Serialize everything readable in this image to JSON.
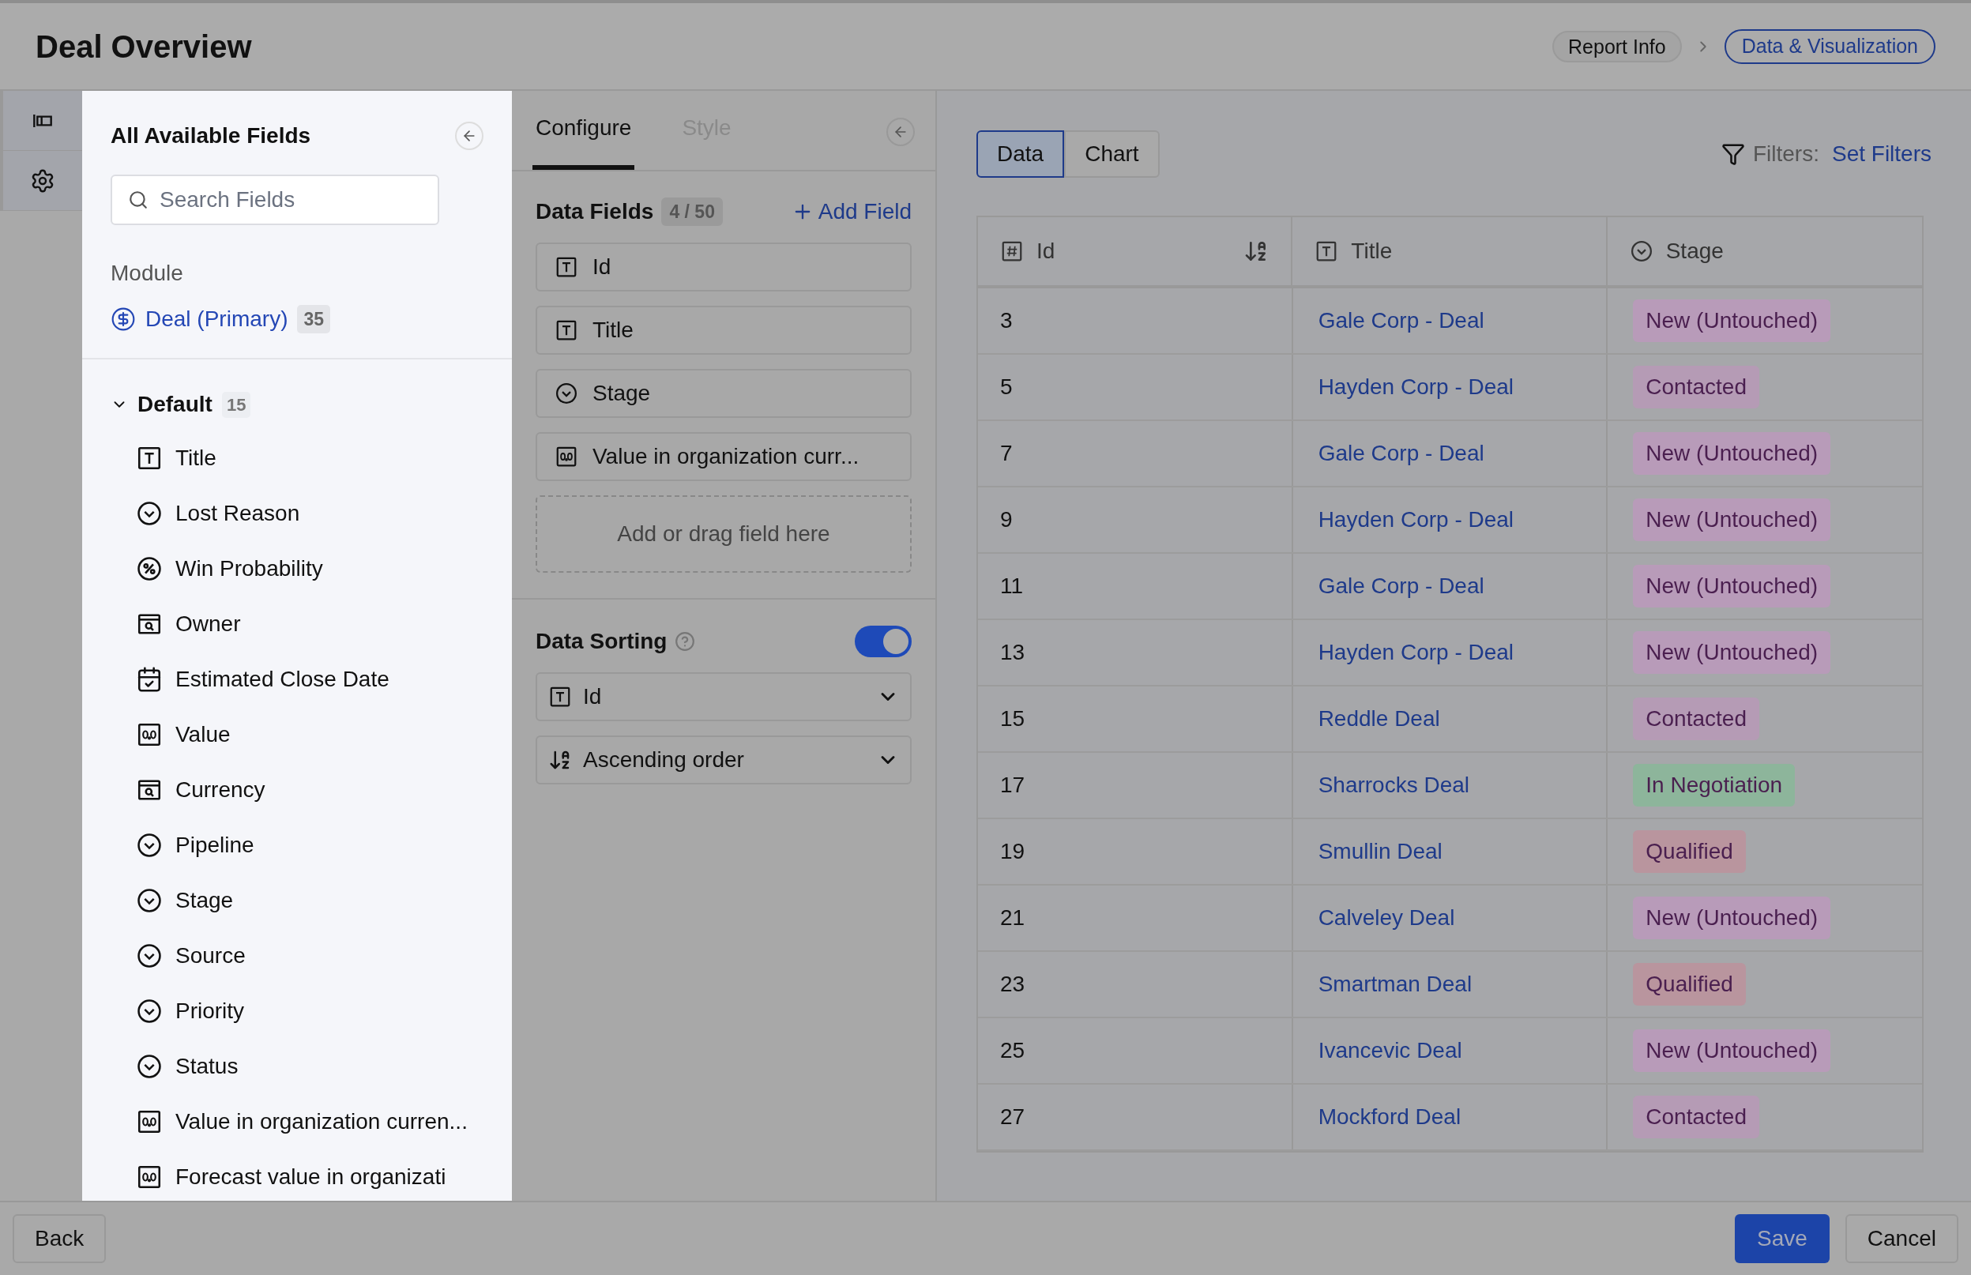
{
  "header": {
    "title": "Deal Overview",
    "steps": [
      {
        "label": "Report Info",
        "selected": false
      },
      {
        "label": "Data & Visualization",
        "selected": true
      }
    ]
  },
  "rail": [
    {
      "kind": "fields",
      "selected": true
    },
    {
      "kind": "settings",
      "selected": true
    }
  ],
  "fields_panel": {
    "title": "All Available Fields",
    "search": {
      "placeholder": "Search Fields"
    },
    "module_label": "Module",
    "module": {
      "name": "Deal (Primary)",
      "count": "35"
    },
    "group": {
      "name": "Default",
      "count": "15",
      "expanded": true,
      "children": [
        {
          "kind": "text",
          "label": "Title"
        },
        {
          "kind": "select",
          "label": "Lost Reason"
        },
        {
          "kind": "percent",
          "label": "Win Probability"
        },
        {
          "kind": "lookup",
          "label": "Owner"
        },
        {
          "kind": "date",
          "label": "Estimated Close Date"
        },
        {
          "kind": "number",
          "label": "Value"
        },
        {
          "kind": "lookup",
          "label": "Currency"
        },
        {
          "kind": "select",
          "label": "Pipeline"
        },
        {
          "kind": "select",
          "label": "Stage"
        },
        {
          "kind": "select",
          "label": "Source"
        },
        {
          "kind": "select",
          "label": "Priority"
        },
        {
          "kind": "select",
          "label": "Status"
        },
        {
          "kind": "number",
          "label": "Value in organization curren..."
        },
        {
          "kind": "number",
          "label": "Forecast value in organizati"
        }
      ]
    }
  },
  "config": {
    "tabs": [
      {
        "label": "Configure",
        "selected": true
      },
      {
        "label": "Style",
        "selected": false
      }
    ],
    "data_fields": {
      "title": "Data Fields",
      "count": "4 / 50",
      "add": "Add Field",
      "items": [
        {
          "kind": "text",
          "label": "Id"
        },
        {
          "kind": "text",
          "label": "Title"
        },
        {
          "kind": "select",
          "label": "Stage"
        },
        {
          "kind": "number",
          "label": "Value in organization curr..."
        }
      ],
      "dropzone": "Add or drag field here"
    },
    "sorting": {
      "title": "Data Sorting",
      "on": true,
      "field": {
        "kind": "text",
        "value": "Id"
      },
      "order": "Ascending order"
    }
  },
  "view": {
    "tabs": [
      {
        "label": "Data",
        "selected": true
      },
      {
        "label": "Chart",
        "selected": false
      }
    ],
    "filters_label": "Filters:",
    "filters_link": "Set Filters",
    "columns": [
      {
        "kind": "id",
        "label": "Id",
        "sorted": true
      },
      {
        "kind": "text",
        "label": "Title",
        "sorted": false
      },
      {
        "kind": "select",
        "label": "Stage",
        "sorted": false
      }
    ],
    "rows": [
      {
        "id": "3",
        "title": "Gale Corp - Deal",
        "stage": "New (Untouched)",
        "color": "#b89bb9"
      },
      {
        "id": "5",
        "title": "Hayden Corp - Deal",
        "stage": "Contacted",
        "color": "#b59bb5"
      },
      {
        "id": "7",
        "title": "Gale Corp - Deal",
        "stage": "New (Untouched)",
        "color": "#b89bb9"
      },
      {
        "id": "9",
        "title": "Hayden Corp - Deal",
        "stage": "New (Untouched)",
        "color": "#b89bb9"
      },
      {
        "id": "11",
        "title": "Gale Corp - Deal",
        "stage": "New (Untouched)",
        "color": "#b89bb9"
      },
      {
        "id": "13",
        "title": "Hayden Corp - Deal",
        "stage": "New (Untouched)",
        "color": "#b89bb9"
      },
      {
        "id": "15",
        "title": "Reddle Deal",
        "stage": "Contacted",
        "color": "#b59bb5"
      },
      {
        "id": "17",
        "title": "Sharrocks Deal",
        "stage": "In Negotiation",
        "color": "#8db59b"
      },
      {
        "id": "19",
        "title": "Smullin Deal",
        "stage": "Qualified",
        "color": "#b9959e"
      },
      {
        "id": "21",
        "title": "Calveley Deal",
        "stage": "New (Untouched)",
        "color": "#b89bb9"
      },
      {
        "id": "23",
        "title": "Smartman Deal",
        "stage": "Qualified",
        "color": "#b9959e"
      },
      {
        "id": "25",
        "title": "Ivancevic Deal",
        "stage": "New (Untouched)",
        "color": "#b89bb9"
      },
      {
        "id": "27",
        "title": "Mockford Deal",
        "stage": "Contacted",
        "color": "#b59bb5"
      }
    ]
  },
  "footer": {
    "back": "Back",
    "save": "Save",
    "cancel": "Cancel"
  }
}
